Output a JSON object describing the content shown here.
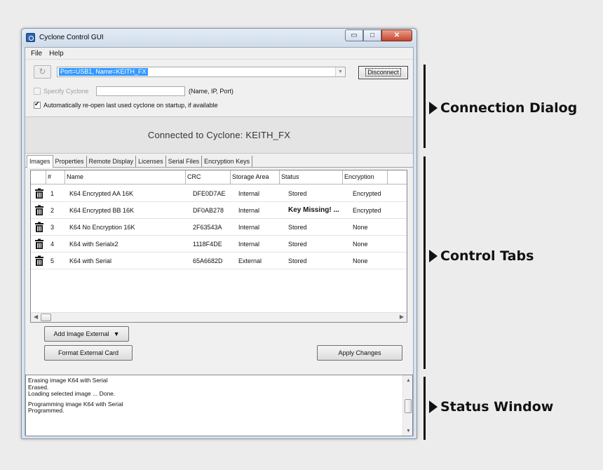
{
  "window": {
    "title": "Cyclone Control GUI",
    "min_glyph": "▭",
    "max_glyph": "□",
    "close_glyph": "✕"
  },
  "menu": [
    "File",
    "Help"
  ],
  "connection": {
    "refresh_glyph": "↻",
    "port_value": "Port=USB1, Name=KEITH_FX",
    "disconnect_label": "Disconnect",
    "specify_label": "Specify Cyclone",
    "specify_value": "",
    "specify_hint": "(Name, IP, Port)",
    "reopen_label": "Automatically re-open last used cyclone on startup, if available",
    "reopen_checked": true,
    "status": "Connected to Cyclone: KEITH_FX"
  },
  "tabs": [
    "Images",
    "Properties",
    "Remote Display",
    "Licenses",
    "Serial Files",
    "Encryption Keys"
  ],
  "grid": {
    "headers": [
      "#",
      "Name",
      "CRC",
      "Storage Area",
      "Status",
      "Encryption"
    ],
    "rows": [
      {
        "num": "1",
        "name": "K64 Encrypted AA 16K",
        "crc": "DFE0D7AE",
        "area": "Internal",
        "status": "Stored",
        "enc": "Encrypted",
        "status_bold": false
      },
      {
        "num": "2",
        "name": "K64 Encrypted BB 16K",
        "crc": "DF0AB278",
        "area": "Internal",
        "status": "Key Missing! ...",
        "enc": "Encrypted",
        "status_bold": true
      },
      {
        "num": "3",
        "name": "K64 No Encryption 16K",
        "crc": "2F63543A",
        "area": "Internal",
        "status": "Stored",
        "enc": "None",
        "status_bold": false
      },
      {
        "num": "4",
        "name": "K64 with Serialx2",
        "crc": "1118F4DE",
        "area": "Internal",
        "status": "Stored",
        "enc": "None",
        "status_bold": false
      },
      {
        "num": "5",
        "name": "K64 with Serial",
        "crc": "65A6682D",
        "area": "External",
        "status": "Stored",
        "enc": "None",
        "status_bold": false
      }
    ]
  },
  "buttons": {
    "add_image": "Add Image External",
    "format_card": "Format External Card",
    "apply": "Apply Changes"
  },
  "status_log": [
    "Erasing image K64 with Serial",
    "Erased.",
    "Loading selected image ... Done.",
    "",
    "Programming image K64 with Serial",
    "Programmed."
  ],
  "callouts": {
    "connection": "Connection Dialog",
    "tabs": "Control Tabs",
    "status": "Status Window"
  }
}
